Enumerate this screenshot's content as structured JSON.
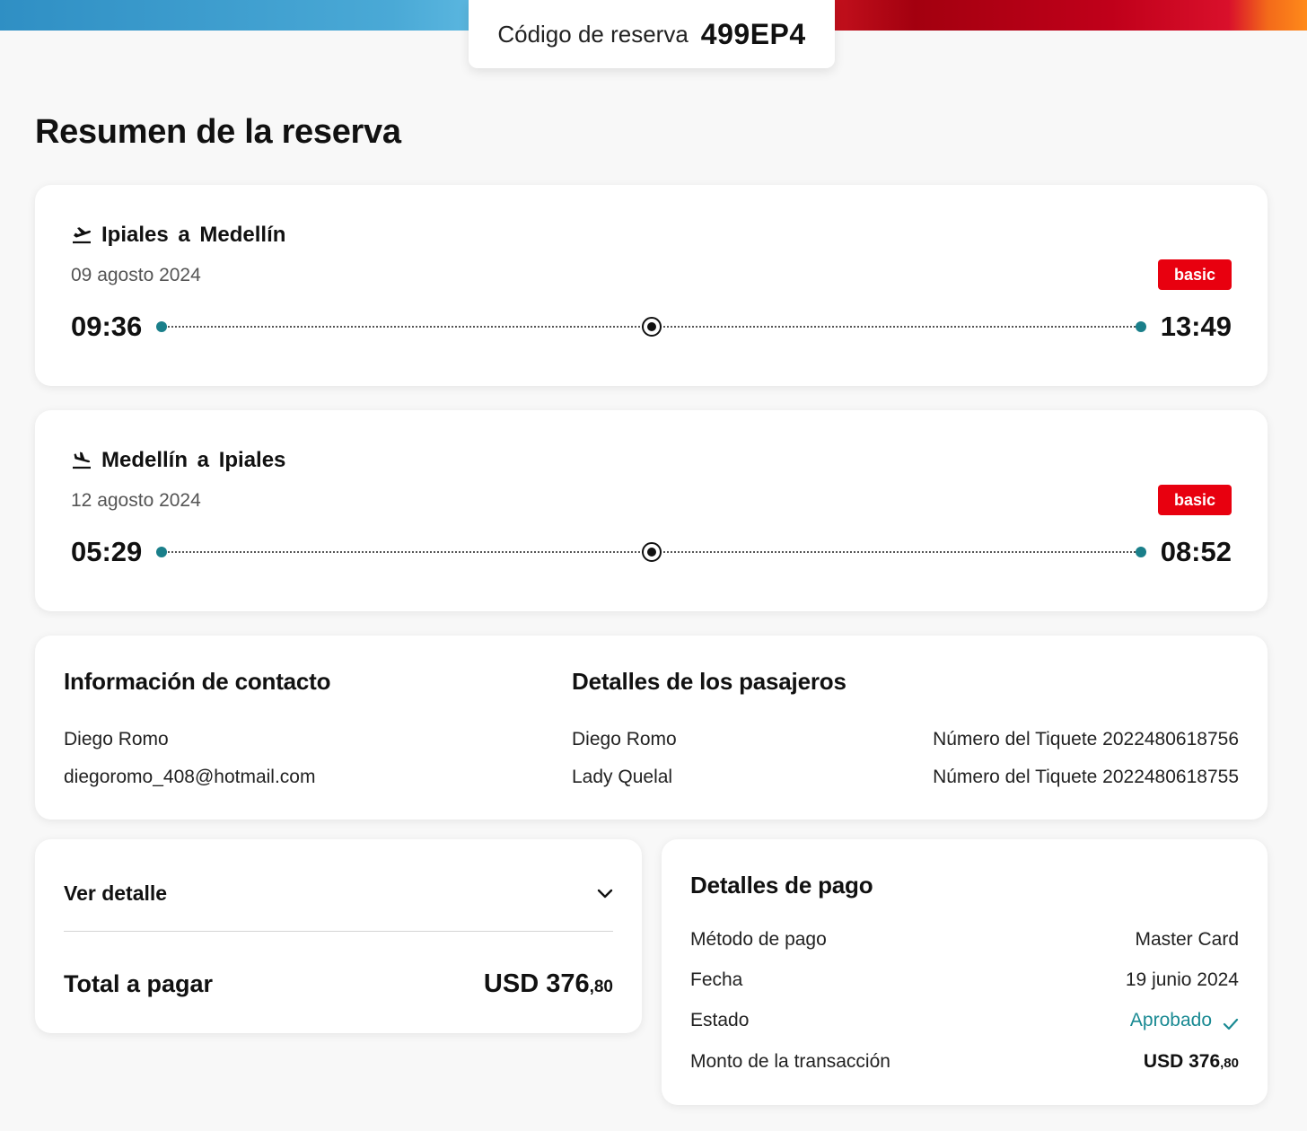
{
  "booking": {
    "code_label": "Código de reserva",
    "code": "499EP4"
  },
  "page_title": "Resumen de la reserva",
  "flights": [
    {
      "icon": "plane-takeoff-icon",
      "origin": "Ipiales",
      "connector": "a",
      "destination": "Medellín",
      "route_title": "Ipiales a Medellín",
      "date": "09 agosto 2024",
      "fare": "basic",
      "departure": "09:36",
      "arrival": "13:49"
    },
    {
      "icon": "plane-landing-icon",
      "origin": "Medellín",
      "connector": "a",
      "destination": "Ipiales",
      "route_title": "Medellín a Ipiales",
      "date": "12 agosto 2024",
      "fare": "basic",
      "departure": "05:29",
      "arrival": "08:52"
    }
  ],
  "contact": {
    "title": "Información de contacto",
    "name": "Diego Romo",
    "email": "diegoromo_408@hotmail.com"
  },
  "passengers": {
    "title": "Detalles de los pasajeros",
    "list": [
      {
        "name": "Diego Romo",
        "ticket": "Número del Tiquete 2022480618756"
      },
      {
        "name": "Lady Quelal",
        "ticket": "Número del Tiquete 2022480618755"
      }
    ]
  },
  "summary": {
    "detail_label": "Ver detalle",
    "total_label": "Total a pagar",
    "total_main": "USD 376",
    "total_cents": ",80"
  },
  "payment": {
    "title": "Detalles de pago",
    "method_label": "Método de pago",
    "method_value": "Master Card",
    "date_label": "Fecha",
    "date_value": "19 junio 2024",
    "status_label": "Estado",
    "status_value": "Aprobado",
    "amount_label": "Monto de la transacción",
    "amount_main": "USD 376",
    "amount_cents": ",80"
  },
  "colors": {
    "accent_red": "#e8000f",
    "teal": "#1a8a93"
  }
}
